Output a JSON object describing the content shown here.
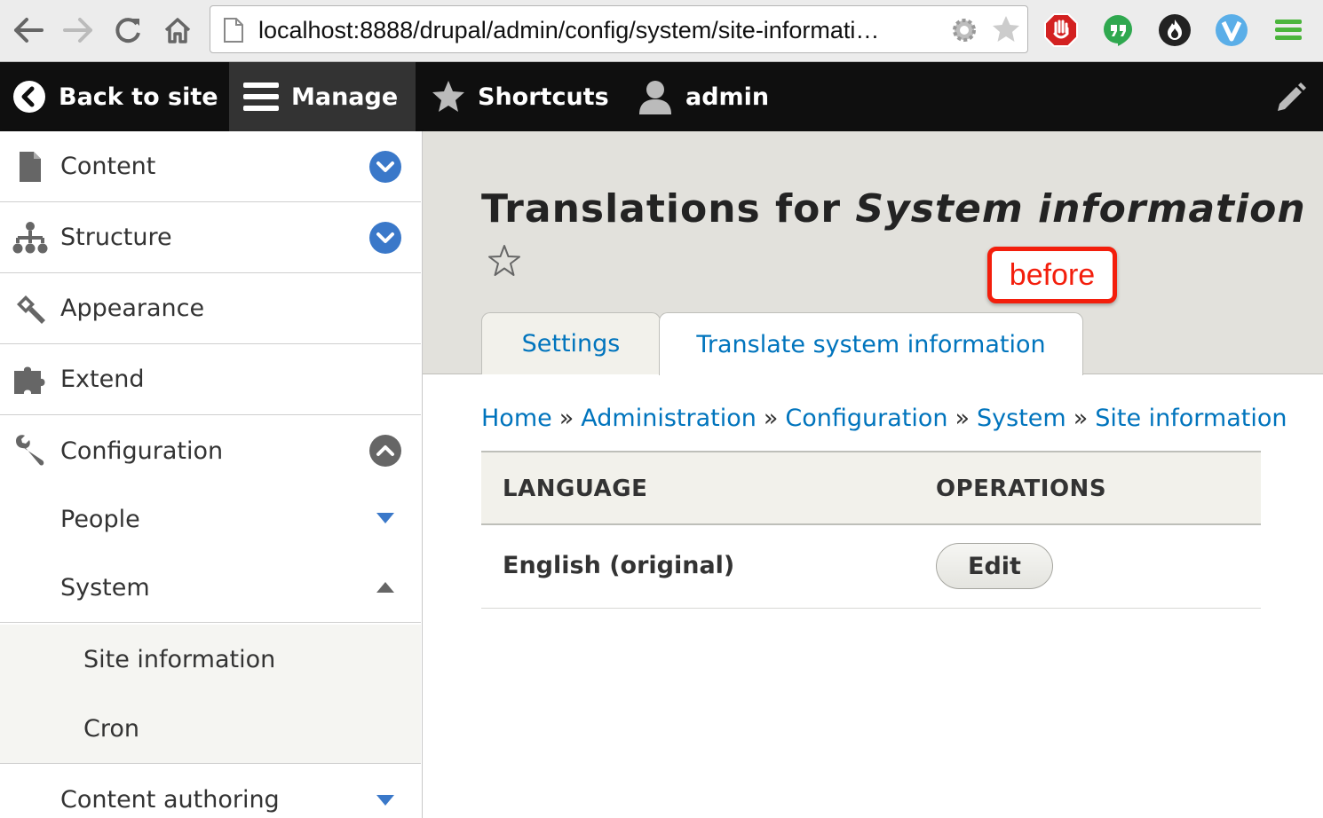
{
  "browser": {
    "url_host": "localhost",
    "url_rest": ":8888/drupal/admin/config/system/site-informati…",
    "icons": [
      "back-arrow-icon",
      "forward-arrow-icon",
      "reload-icon",
      "home-icon",
      "page-icon",
      "settings-gear-icon",
      "bookmark-star-icon",
      "adblock-icon",
      "hangouts-icon",
      "fire-extension-icon",
      "v-extension-icon",
      "menu-icon"
    ]
  },
  "toolbar": {
    "back_to_site": "Back to site",
    "manage": "Manage",
    "shortcuts": "Shortcuts",
    "user": "admin"
  },
  "sidebar": {
    "items": [
      {
        "label": "Content",
        "icon": "file-icon",
        "toggle": "expand"
      },
      {
        "label": "Structure",
        "icon": "sitemap-icon",
        "toggle": "expand"
      },
      {
        "label": "Appearance",
        "icon": "paintbrush-icon"
      },
      {
        "label": "Extend",
        "icon": "puzzle-icon"
      },
      {
        "label": "Configuration",
        "icon": "wrench-icon",
        "toggle": "collapse"
      }
    ],
    "subitems": [
      {
        "label": "People"
      },
      {
        "label": "System"
      },
      {
        "label": "Site information"
      },
      {
        "label": "Cron"
      },
      {
        "label": "Content authoring"
      }
    ]
  },
  "page": {
    "title_prefix": "Translations for ",
    "title_emphasis": "System information",
    "annotation": "before",
    "tabs": [
      {
        "label": "Settings",
        "active": false
      },
      {
        "label": "Translate system information",
        "active": true
      }
    ],
    "breadcrumb": [
      "Home",
      "Administration",
      "Configuration",
      "System",
      "Site information"
    ],
    "breadcrumb_separator": "»",
    "table": {
      "headers": [
        "LANGUAGE",
        "OPERATIONS"
      ],
      "rows": [
        {
          "language": "English (original)",
          "operation": "Edit"
        }
      ]
    }
  },
  "colors": {
    "link": "#0074bd",
    "toolbar_bg": "#0f0f0f",
    "header_band": "#e2e1dc",
    "callout": "#f31e0c",
    "toggle_blue": "#3a78c9"
  }
}
